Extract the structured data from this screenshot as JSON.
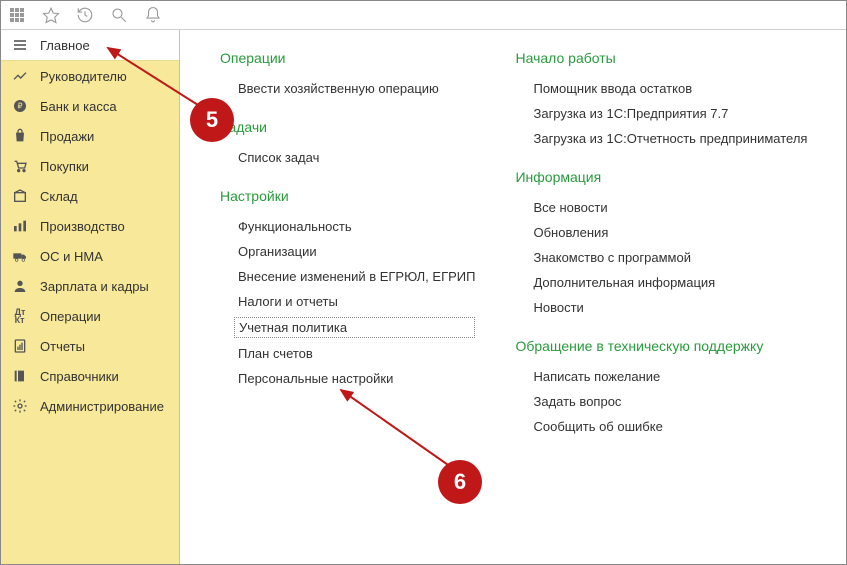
{
  "sidebar": {
    "items": [
      {
        "label": "Главное"
      },
      {
        "label": "Руководителю"
      },
      {
        "label": "Банк и касса"
      },
      {
        "label": "Продажи"
      },
      {
        "label": "Покупки"
      },
      {
        "label": "Склад"
      },
      {
        "label": "Производство"
      },
      {
        "label": "ОС и НМА"
      },
      {
        "label": "Зарплата и кадры"
      },
      {
        "label": "Операции"
      },
      {
        "label": "Отчеты"
      },
      {
        "label": "Справочники"
      },
      {
        "label": "Администрирование"
      }
    ]
  },
  "col1": {
    "sec1": {
      "title": "Операции",
      "items": [
        "Ввести хозяйственную операцию"
      ]
    },
    "sec2": {
      "title": "Задачи",
      "items": [
        "Список задач"
      ]
    },
    "sec3": {
      "title": "Настройки",
      "items": [
        "Функциональность",
        "Организации",
        "Внесение изменений в ЕГРЮЛ, ЕГРИП",
        "Налоги и отчеты",
        "Учетная политика",
        "План счетов",
        "Персональные настройки"
      ]
    }
  },
  "col2": {
    "sec1": {
      "title": "Начало работы",
      "items": [
        "Помощник ввода остатков",
        "Загрузка из 1С:Предприятия 7.7",
        "Загрузка из 1С:Отчетность предпринимателя"
      ]
    },
    "sec2": {
      "title": "Информация",
      "items": [
        "Все новости",
        "Обновления",
        "Знакомство с программой",
        "Дополнительная информация",
        "Новости"
      ]
    },
    "sec3": {
      "title": "Обращение в техническую поддержку",
      "items": [
        "Написать пожелание",
        "Задать вопрос",
        "Сообщить об ошибке"
      ]
    }
  },
  "callouts": {
    "c5": "5",
    "c6": "6"
  }
}
